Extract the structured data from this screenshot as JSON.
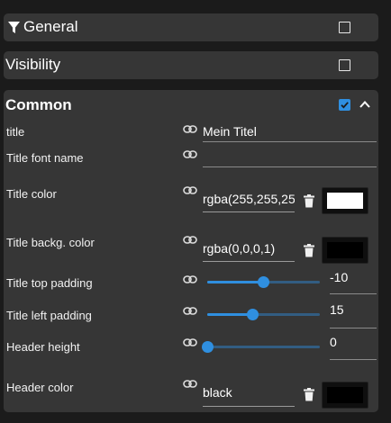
{
  "sections": {
    "general": {
      "label": "General",
      "checked": false
    },
    "visibility": {
      "label": "Visibility",
      "checked": false
    },
    "common": {
      "label": "Common",
      "checked": true,
      "expanded": true
    }
  },
  "fields": {
    "title": {
      "label": "title",
      "value": "Mein Titel"
    },
    "title_font_name": {
      "label": "Title font name",
      "value": ""
    },
    "title_color": {
      "label": "Title color",
      "value": "rgba(255,255,255,1)",
      "swatch": "#ffffff"
    },
    "title_backg_color": {
      "label": "Title backg. color",
      "value": "rgba(0,0,0,1)",
      "swatch": "#000000"
    },
    "title_top_padding": {
      "label": "Title top padding",
      "value": "-10",
      "fraction": 0.5
    },
    "title_left_padding": {
      "label": "Title left padding",
      "value": "15",
      "fraction": 0.4
    },
    "header_height": {
      "label": "Header height",
      "value": "0",
      "fraction": 0.0
    },
    "header_color": {
      "label": "Header color",
      "value": "black",
      "swatch": "#000000"
    }
  },
  "colors": {
    "accent": "#2f8fe0",
    "panel": "#363636",
    "background": "#1b1b1b"
  },
  "icons": [
    "filter-icon",
    "link-icon",
    "trash-icon",
    "chevron-up-icon",
    "checkbox-icon"
  ]
}
